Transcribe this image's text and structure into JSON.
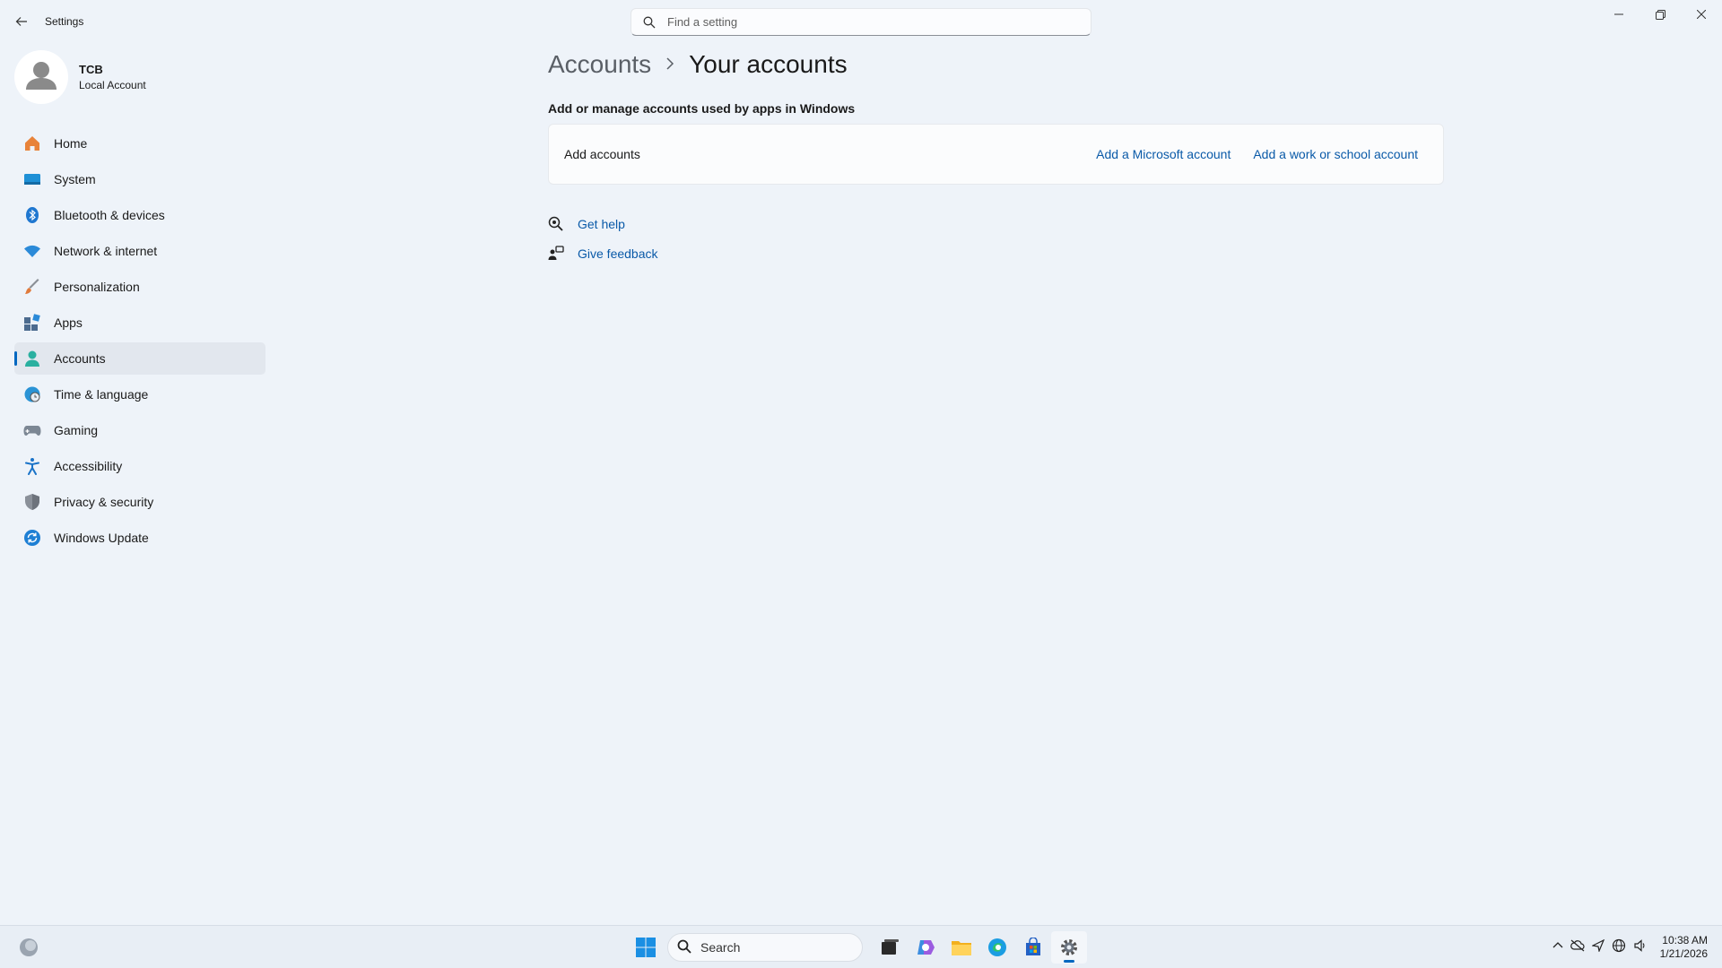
{
  "window": {
    "title": "Settings"
  },
  "search": {
    "placeholder": "Find a setting"
  },
  "profile": {
    "name": "TCB",
    "type": "Local Account"
  },
  "sidebar": {
    "items": [
      {
        "label": "Home",
        "icon": "home-icon",
        "color": "#e8833a"
      },
      {
        "label": "System",
        "icon": "system-icon",
        "color": "#1e90d6"
      },
      {
        "label": "Bluetooth & devices",
        "icon": "bluetooth-icon",
        "color": "#1f77d0"
      },
      {
        "label": "Network & internet",
        "icon": "wifi-icon",
        "color": "#2b8ad8"
      },
      {
        "label": "Personalization",
        "icon": "brush-icon",
        "color": "#e07a3b"
      },
      {
        "label": "Apps",
        "icon": "apps-icon",
        "color": "#4c6b8f"
      },
      {
        "label": "Accounts",
        "icon": "accounts-icon",
        "color": "#2ab0a0",
        "active": true
      },
      {
        "label": "Time & language",
        "icon": "globe-clock-icon",
        "color": "#2a93d5"
      },
      {
        "label": "Gaming",
        "icon": "gamepad-icon",
        "color": "#7c8794"
      },
      {
        "label": "Accessibility",
        "icon": "accessibility-icon",
        "color": "#1a73c8"
      },
      {
        "label": "Privacy & security",
        "icon": "shield-icon",
        "color": "#8a9099"
      },
      {
        "label": "Windows Update",
        "icon": "update-icon",
        "color": "#1e7fd4"
      }
    ]
  },
  "main": {
    "breadcrumb_parent": "Accounts",
    "breadcrumb_current": "Your accounts",
    "section_heading": "Add or manage accounts used by apps in Windows",
    "card": {
      "label": "Add accounts",
      "link_microsoft": "Add a Microsoft account",
      "link_work": "Add a work or school account"
    },
    "help": {
      "get_help": "Get help",
      "give_feedback": "Give feedback"
    }
  },
  "taskbar": {
    "search_label": "Search",
    "time": "10:38 AM",
    "date": "1/21/2026"
  },
  "colors": {
    "accent": "#0067c0",
    "link": "#0a5aa8"
  }
}
